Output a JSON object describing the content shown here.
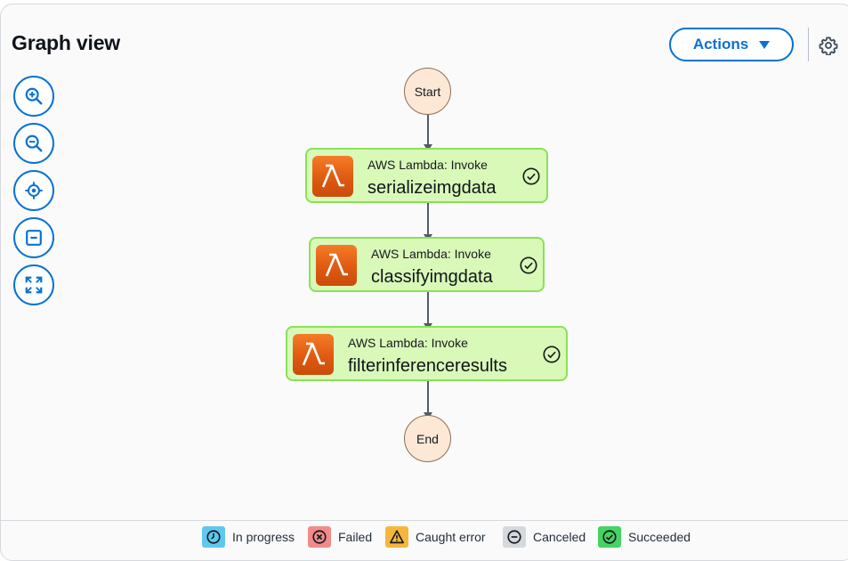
{
  "header": {
    "title": "Graph view",
    "actions_label": "Actions"
  },
  "graph": {
    "start_label": "Start",
    "end_label": "End",
    "states": [
      {
        "type": "AWS Lambda: Invoke",
        "name": "serializeimgdata",
        "status": "Succeeded"
      },
      {
        "type": "AWS Lambda: Invoke",
        "name": "classifyimgdata",
        "status": "Succeeded"
      },
      {
        "type": "AWS Lambda: Invoke",
        "name": "filterinferenceresults",
        "status": "Succeeded"
      }
    ]
  },
  "toolbar": {
    "buttons": [
      "zoom-in-icon",
      "zoom-out-icon",
      "center-icon",
      "collapse-icon",
      "fit-to-screen-icon"
    ]
  },
  "legend": {
    "items": [
      {
        "label": "In progress",
        "color": "#5fc8ef",
        "icon": "clock-icon"
      },
      {
        "label": "Failed",
        "color": "#f18b8b",
        "icon": "x-circle-icon"
      },
      {
        "label": "Caught error",
        "color": "#f5b73b",
        "icon": "warning-icon"
      },
      {
        "label": "Canceled",
        "color": "#d5d9dd",
        "icon": "minus-circle-icon"
      },
      {
        "label": "Succeeded",
        "color": "#45d363",
        "icon": "check-circle-icon"
      }
    ]
  },
  "colors": {
    "accent": "#0972d3",
    "task_fill": "#d9f9b8",
    "task_border": "#8be05a",
    "start_end_fill": "#fde8d6"
  }
}
